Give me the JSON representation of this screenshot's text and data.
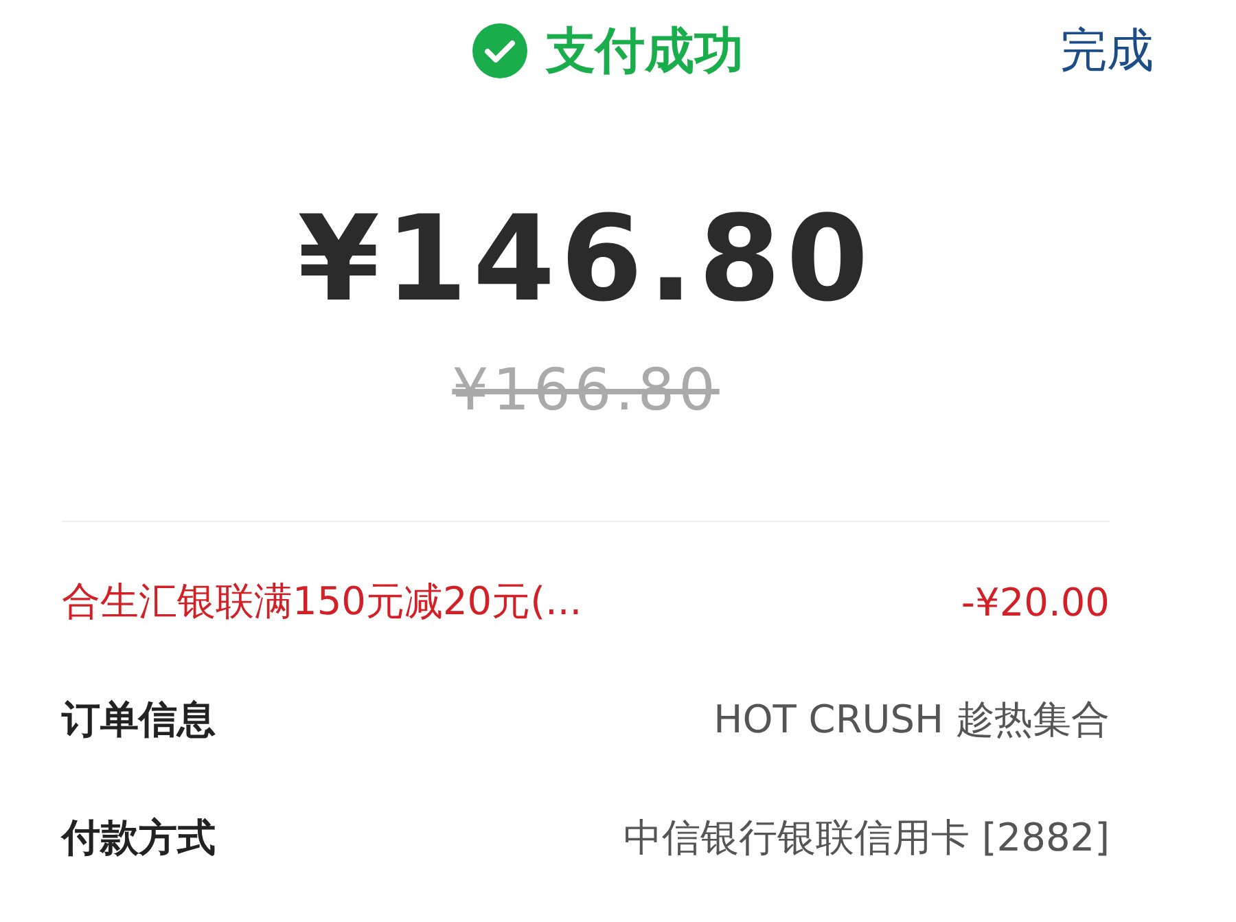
{
  "header": {
    "status": "支付成功",
    "done_button": "完成"
  },
  "amount": "¥146.80",
  "original_amount": "¥166.80",
  "discount": {
    "label": "合生汇银联满150元减20元(...",
    "value": "-¥20.00"
  },
  "details": [
    {
      "label": "订单信息",
      "value": "HOT CRUSH 趁热集合"
    },
    {
      "label": "付款方式",
      "value": "中信银行银联信用卡 [2882]"
    }
  ]
}
